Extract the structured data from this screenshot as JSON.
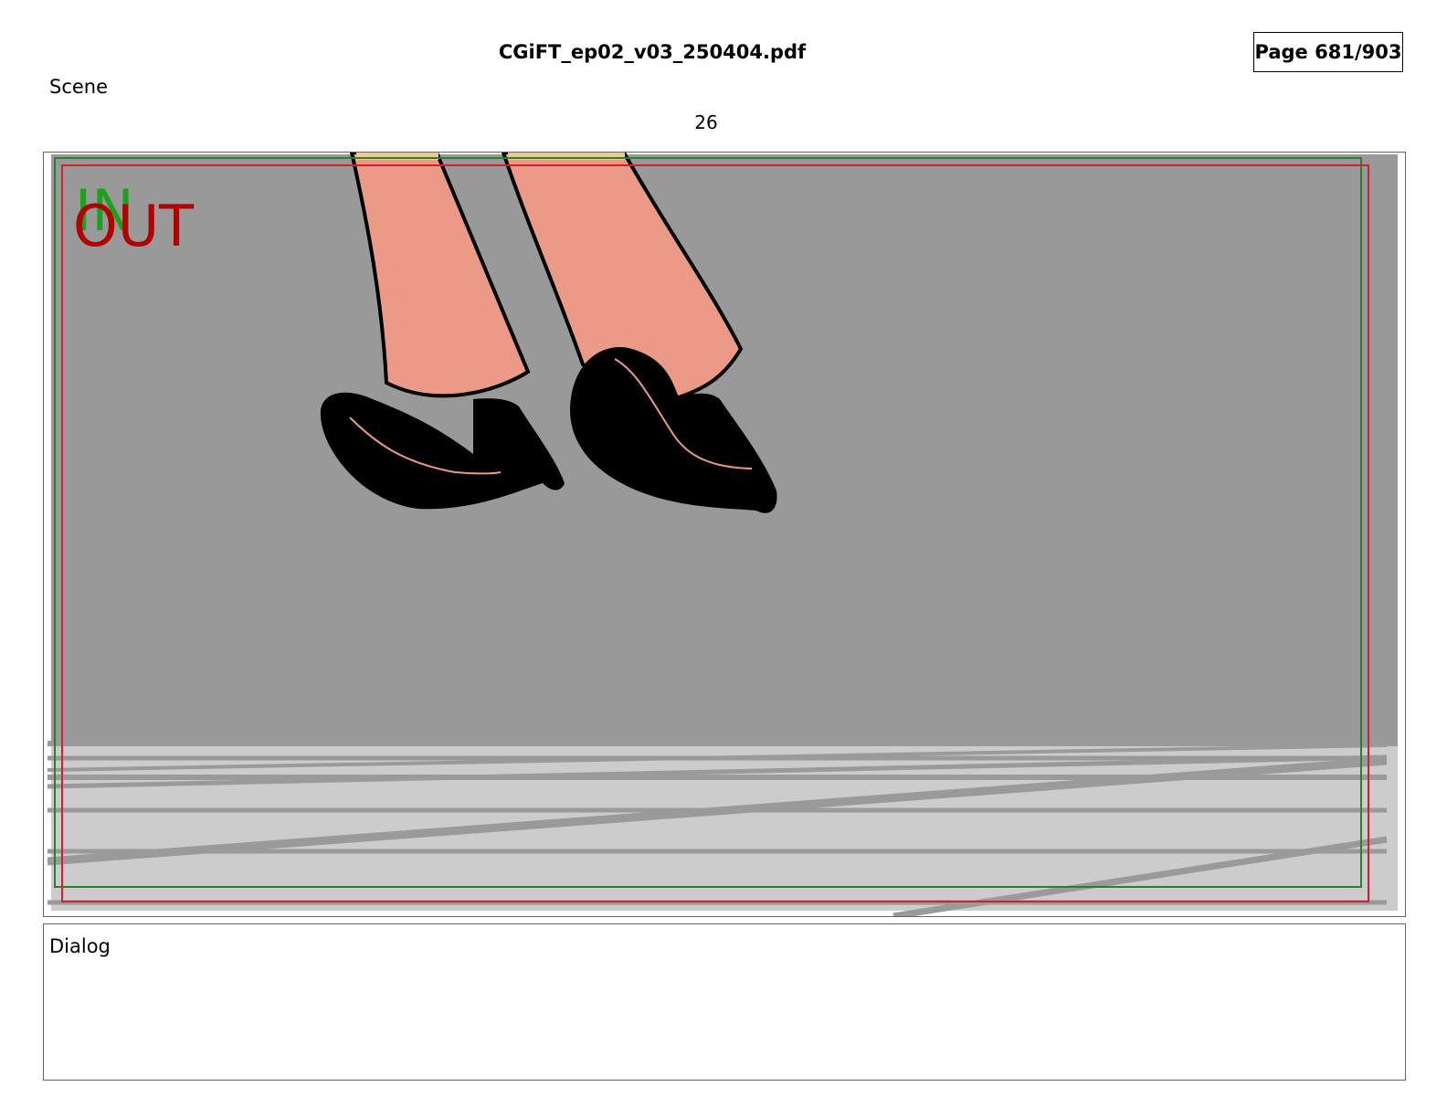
{
  "header": {
    "file_name": "CGiFT_ep02_v03_250404.pdf",
    "page_label": "Page 681/903"
  },
  "scene": {
    "label": "Scene",
    "number": "26"
  },
  "panel": {
    "in_marker": "IN",
    "out_marker": "OUT",
    "colors": {
      "in_marker": "#1aa31a",
      "out_marker": "#b00000",
      "background_wall": "#999999",
      "floor": "#cccccc",
      "floor_lines": "#9a9a9a",
      "skin": "#eb9a88",
      "shoes": "#000000",
      "safe_frame_green": "#2e7d32",
      "safe_frame_red": "#d0202a"
    }
  },
  "dialog": {
    "label": "Dialog"
  }
}
